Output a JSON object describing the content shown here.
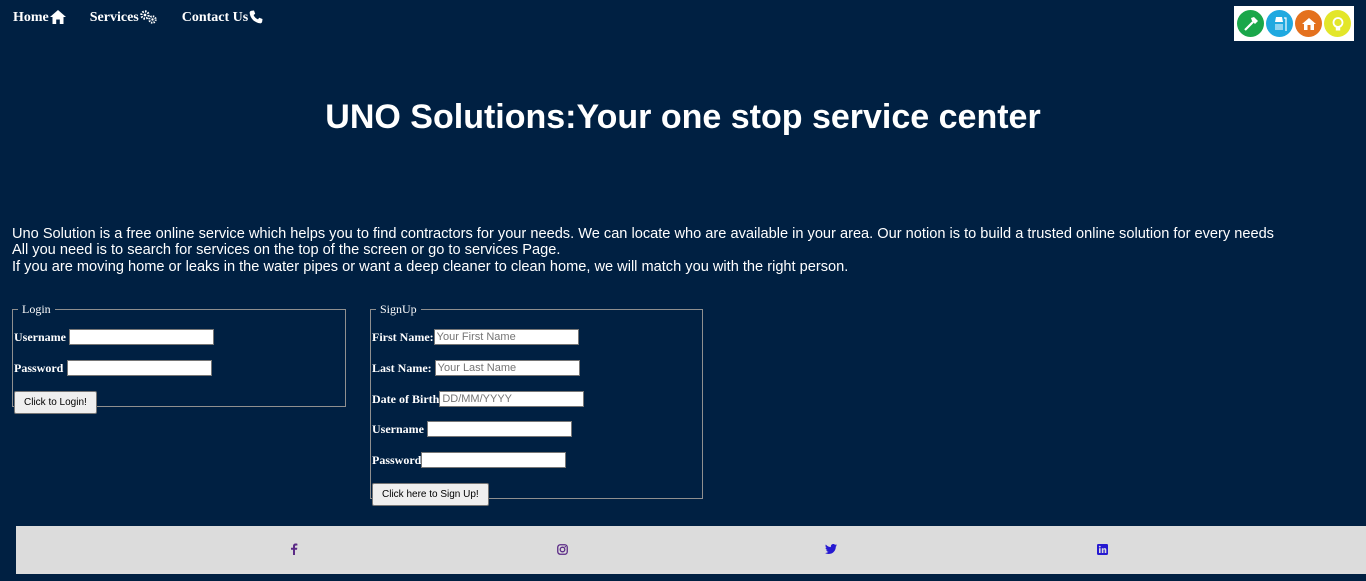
{
  "nav": {
    "items": [
      {
        "label": "Home",
        "icon": "home-icon"
      },
      {
        "label": "Services",
        "icon": "gears-icon"
      },
      {
        "label": "Contact Us",
        "icon": "phone-icon"
      }
    ]
  },
  "logo": {
    "icons": [
      "hammer-icon",
      "shower-icon",
      "house-icon",
      "lightbulb-icon"
    ],
    "colors": [
      "#1aa74a",
      "#1fa9e0",
      "#e4711e",
      "#e3e62a"
    ]
  },
  "heading": "UNO Solutions:Your one stop service center",
  "intro": [
    "Uno Solution is a free online service which helps you to find contractors for your needs. We can locate who are available in your area. Our notion is to build a trusted online solution for every needs",
    "All you need is to search for services on the top of the screen or go to services Page.",
    "If you are moving home or leaks in the water pipes or want a deep cleaner to clean home, we will match you with the right person."
  ],
  "login": {
    "legend": "Login",
    "username_label": "Username",
    "username_value": "",
    "password_label": "Password",
    "password_value": "",
    "button": "Click to Login!"
  },
  "signup": {
    "legend": "SignUp",
    "first_name_label": "First Name:",
    "first_name_placeholder": "Your First Name",
    "last_name_label": "Last Name:",
    "last_name_placeholder": "Your Last Name",
    "dob_label": "Date of Birth",
    "dob_placeholder": "DD/MM/YYYY",
    "username_label": "Username",
    "password_label": "Password",
    "button": "Click here to Sign Up!"
  },
  "footer": {
    "icons": [
      "facebook-icon",
      "instagram-icon",
      "twitter-icon",
      "linkedin-icon"
    ]
  },
  "colors": {
    "background": "#002042",
    "footer": "#dcdcdc",
    "social": "#2619d1",
    "facebook": "#5b2a86"
  }
}
